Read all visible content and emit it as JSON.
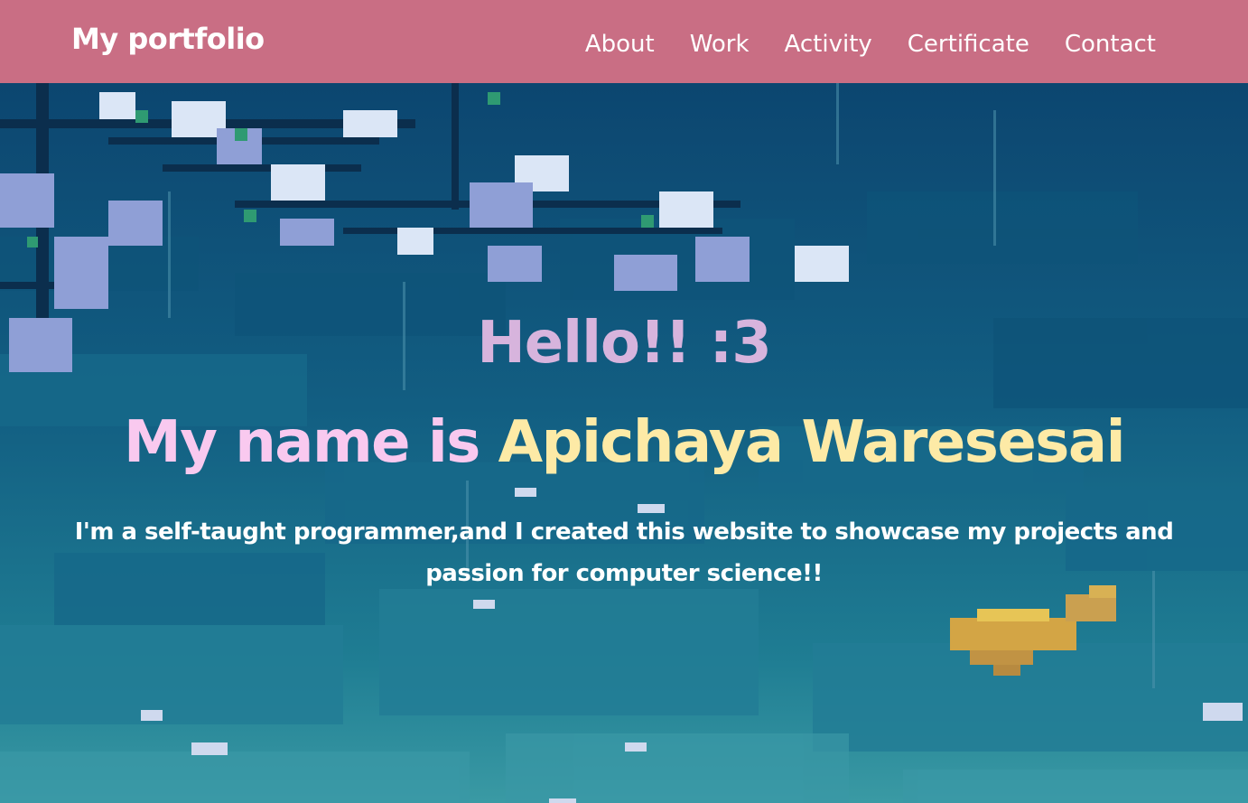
{
  "navbar": {
    "brand": "My portfolio",
    "links": [
      {
        "label": "About"
      },
      {
        "label": "Work"
      },
      {
        "label": "Activity"
      },
      {
        "label": "Certificate"
      },
      {
        "label": "Contact"
      }
    ],
    "background_color": "#c96e84"
  },
  "hero": {
    "greeting": "Hello!! :3",
    "name_prefix": "My name is",
    "name": "Apichaya Waresesai",
    "intro": "I'm a self-taught programmer,and I created this website to showcase my projects and passion for computer science!!",
    "colors": {
      "greeting": "#d7b4dd",
      "name_prefix": "#f9c9ef",
      "name": "#fdeaa6",
      "intro": "#ffffff"
    }
  }
}
